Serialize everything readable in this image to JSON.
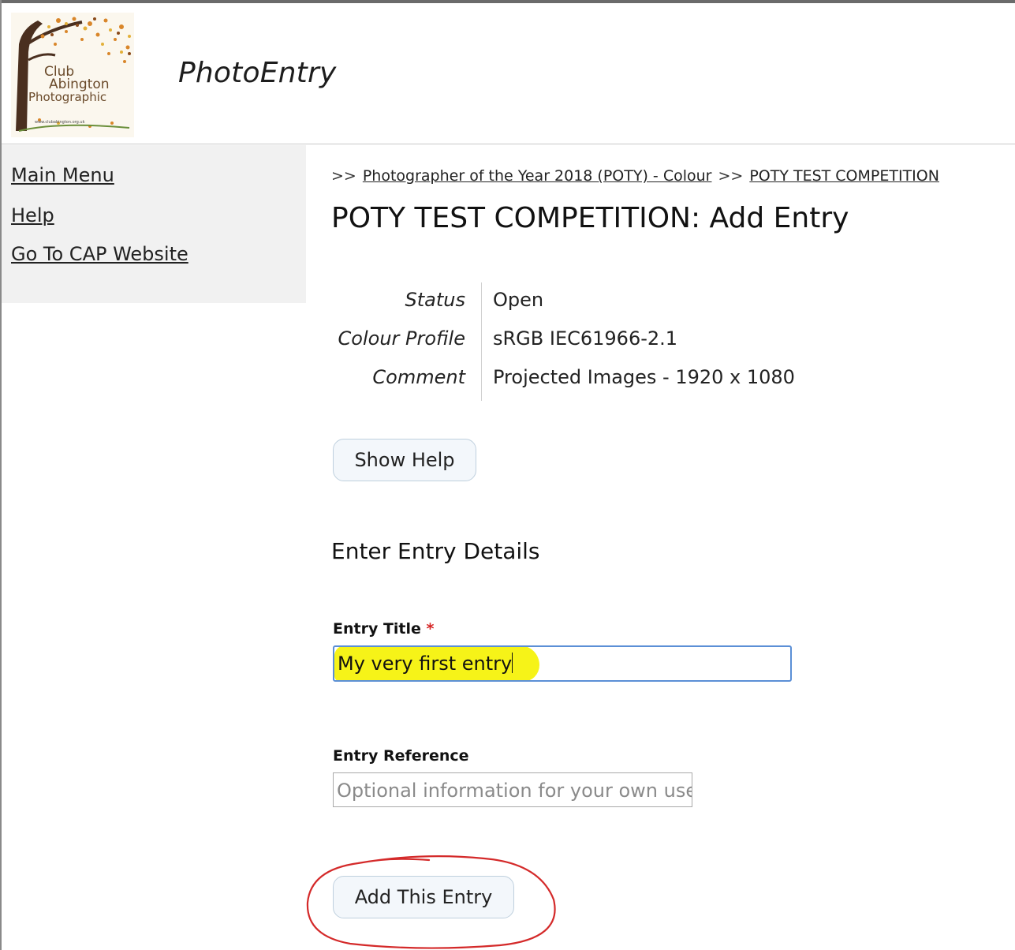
{
  "header": {
    "logo_text": [
      "Club",
      "Abington",
      "Photographic",
      "www.clubabington.org.uk"
    ],
    "app_title": "PhotoEntry"
  },
  "sidebar": {
    "items": [
      {
        "label": "Main Menu"
      },
      {
        "label": "Help"
      },
      {
        "label": "Go To CAP Website"
      }
    ]
  },
  "breadcrumb": {
    "separator": ">>",
    "items": [
      {
        "label": "Photographer of the Year 2018 (POTY) - Colour"
      },
      {
        "label": "POTY TEST COMPETITION"
      }
    ]
  },
  "page_title": "POTY TEST COMPETITION: Add Entry",
  "details": [
    {
      "key": "Status",
      "value": "Open"
    },
    {
      "key": "Colour Profile",
      "value": "sRGB IEC61966-2.1"
    },
    {
      "key": "Comment",
      "value": "Projected Images - 1920 x 1080"
    }
  ],
  "show_help_label": "Show Help",
  "section_heading": "Enter Entry Details",
  "form": {
    "entry_title_label": "Entry Title",
    "required_marker": "*",
    "entry_title_value": "My very first entry",
    "entry_reference_label": "Entry Reference",
    "entry_reference_placeholder": "Optional information for your own use"
  },
  "add_entry_label": "Add This Entry",
  "colors": {
    "highlight": "#f6f318",
    "annotation_circle": "#d42a2a",
    "required": "#d62424",
    "input_focus_border": "#5b8fd6"
  }
}
